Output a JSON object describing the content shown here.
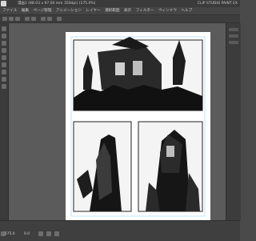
{
  "window": {
    "title": "漫画1 (98.03 x 97.00 mm 350dpi) (175.0%)",
    "app_name": "CLIP STUDIO PAINT EX"
  },
  "menu": {
    "items": [
      "ファイル",
      "編集",
      "ページ管理",
      "アニメーション",
      "レイヤー",
      "選択範囲",
      "表示",
      "フィルター",
      "ウィンドウ",
      "ヘルプ"
    ]
  },
  "status": {
    "zoom": "175.0",
    "angle": "0.0"
  }
}
